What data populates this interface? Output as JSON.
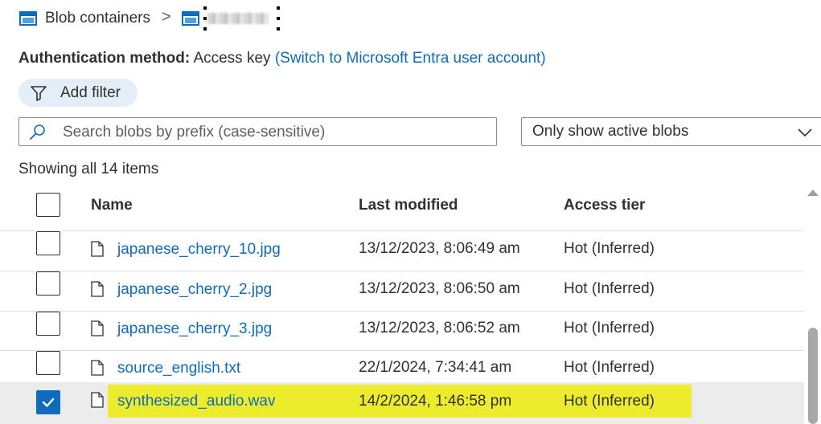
{
  "breadcrumb": {
    "root_label": "Blob containers",
    "separator": ">"
  },
  "auth": {
    "label": "Authentication method:",
    "value": "Access key",
    "link": "(Switch to Microsoft Entra user account)"
  },
  "filter": {
    "add_filter_label": "Add filter"
  },
  "search": {
    "placeholder": "Search blobs by prefix (case-sensitive)",
    "value": ""
  },
  "blob_filter_select": {
    "selected": "Only show active blobs"
  },
  "status": {
    "count_text": "Showing all 14 items"
  },
  "table": {
    "columns": {
      "name": "Name",
      "last_modified": "Last modified",
      "access_tier": "Access tier"
    },
    "rows": [
      {
        "name": "japanese_cherry_10.jpg",
        "last_modified": "13/12/2023, 8:06:49 am",
        "access_tier": "Hot (Inferred)",
        "checked": false
      },
      {
        "name": "japanese_cherry_2.jpg",
        "last_modified": "13/12/2023, 8:06:50 am",
        "access_tier": "Hot (Inferred)",
        "checked": false
      },
      {
        "name": "japanese_cherry_3.jpg",
        "last_modified": "13/12/2023, 8:06:52 am",
        "access_tier": "Hot (Inferred)",
        "checked": false
      },
      {
        "name": "source_english.txt",
        "last_modified": "22/1/2024, 7:34:41 am",
        "access_tier": "Hot (Inferred)",
        "checked": false
      },
      {
        "name": "synthesized_audio.wav",
        "last_modified": "14/2/2024, 1:46:58 pm",
        "access_tier": "Hot (Inferred)",
        "checked": true
      }
    ]
  },
  "colors": {
    "link": "#0f6cbd",
    "checkbox_checked": "#0f6cbd",
    "highlight": "#ecec2c",
    "pill_bg": "#e3eef8",
    "selected_row": "#ececec"
  },
  "icons": [
    "container-icon",
    "chevron-right-icon",
    "funnel-icon",
    "search-icon",
    "chevron-down-icon",
    "file-icon",
    "checkmark-icon",
    "scroll-up-arrow-icon"
  ]
}
